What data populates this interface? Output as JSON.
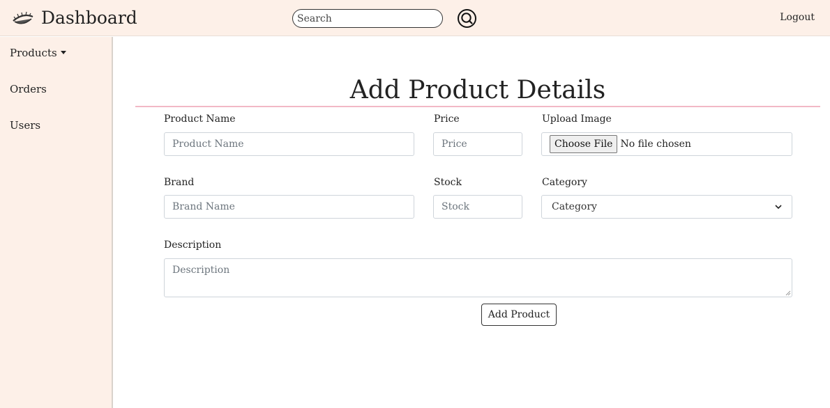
{
  "header": {
    "brand": "Dashboard",
    "logo_icon": "eyelash-logo-icon",
    "search_placeholder": "Search",
    "search_icon": "search-icon",
    "logout": "Logout"
  },
  "sidebar": {
    "items": [
      {
        "label": "Products",
        "has_dropdown": true
      },
      {
        "label": "Orders"
      },
      {
        "label": "Users"
      }
    ]
  },
  "form": {
    "title": "Add Product Details",
    "product_name": {
      "label": "Product Name",
      "placeholder": "Product Name",
      "value": ""
    },
    "price": {
      "label": "Price",
      "placeholder": "Price",
      "value": ""
    },
    "upload_image": {
      "label": "Upload Image",
      "button": "Choose File",
      "status": "No file chosen"
    },
    "brand": {
      "label": "Brand",
      "placeholder": "Brand Name",
      "value": ""
    },
    "stock": {
      "label": "Stock",
      "placeholder": "Stock",
      "value": ""
    },
    "category": {
      "label": "Category",
      "selected": "Category"
    },
    "description": {
      "label": "Description",
      "placeholder": "Description",
      "value": ""
    },
    "submit": "Add Product"
  },
  "colors": {
    "header_bg": "#fdf0e8",
    "sidebar_bg": "#fdf0e8",
    "title_rule": "#f2b8c6"
  }
}
